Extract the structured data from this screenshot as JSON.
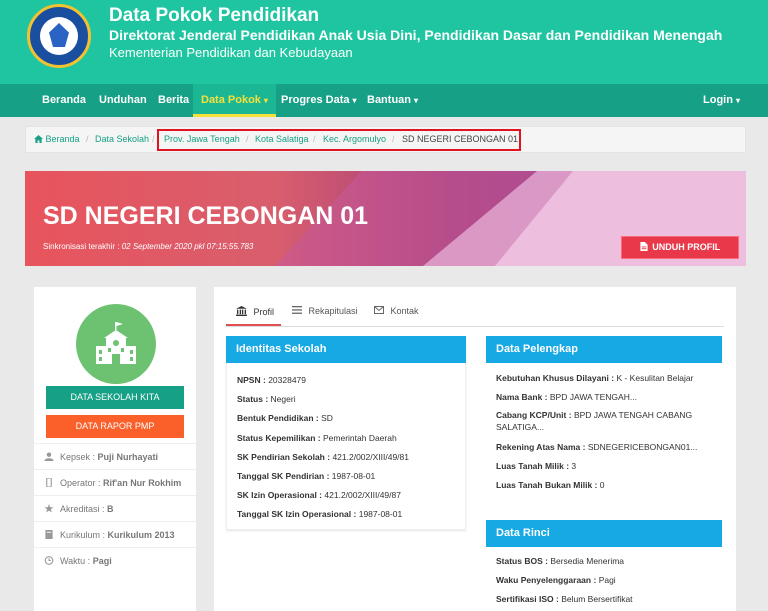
{
  "header": {
    "title": "Data Pokok Pendidikan",
    "subtitle": "Direktorat Jenderal Pendidikan Anak Usia Dini, Pendidikan Dasar dan Pendidikan Menengah",
    "ministry": "Kementerian Pendidikan dan Kebudayaan"
  },
  "nav": {
    "items": [
      "Beranda",
      "Unduhan",
      "Berita",
      "Data Pokok",
      "Progres Data",
      "Bantuan"
    ],
    "login": "Login",
    "caret": "▾"
  },
  "breadcrumb": {
    "home": "Beranda",
    "items": [
      "Data Sekolah",
      "Prov. Jawa Tengah",
      "Kota Salatiga",
      "Kec. Argomulyo"
    ],
    "current": "SD NEGERI CEBONGAN 01",
    "sep": "/"
  },
  "banner": {
    "title": "SD NEGERI CEBONGAN 01",
    "sync_label": "Sinkronisasi terakhir :",
    "sync_value": "02 September 2020 pkl 07:15:55.783",
    "download_label": "UNDUH PROFIL"
  },
  "sidebar": {
    "btn_green": "DATA SEKOLAH KITA",
    "btn_orange": "DATA RAPOR PMP",
    "rows": [
      {
        "label": "Kepsek :",
        "value": "Puji Nurhayati"
      },
      {
        "label": "Operator :",
        "value": "Rif'an Nur Rokhim"
      },
      {
        "label": "Akreditasi :",
        "value": "B"
      },
      {
        "label": "Kurikulum :",
        "value": "Kurikulum 2013"
      },
      {
        "label": "Waktu :",
        "value": "Pagi"
      }
    ]
  },
  "tabs": [
    "Profil",
    "Rekapitulasi",
    "Kontak"
  ],
  "identitas": {
    "title": "Identitas Sekolah",
    "rows": [
      {
        "label": "NPSN :",
        "value": "20328479"
      },
      {
        "label": "Status :",
        "value": "Negeri"
      },
      {
        "label": "Bentuk Pendidikan :",
        "value": "SD"
      },
      {
        "label": "Status Kepemilikan :",
        "value": "Pemerintah Daerah"
      },
      {
        "label": "SK Pendirian Sekolah :",
        "value": "421.2/002/XIII/49/81"
      },
      {
        "label": "Tanggal SK Pendirian :",
        "value": "1987-08-01"
      },
      {
        "label": "SK Izin Operasional :",
        "value": "421.2/002/XIII/49/87"
      },
      {
        "label": "Tanggal SK Izin Operasional :",
        "value": "1987-08-01"
      }
    ]
  },
  "pelengkap": {
    "title": "Data Pelengkap",
    "rows": [
      {
        "label": "Kebutuhan Khusus Dilayani :",
        "value": "K - Kesulitan Belajar"
      },
      {
        "label": "Nama Bank :",
        "value": "BPD JAWA TENGAH..."
      },
      {
        "label": "Cabang KCP/Unit :",
        "value": "BPD JAWA TENGAH CABANG SALATIGA..."
      },
      {
        "label": "Rekening Atas Nama :",
        "value": "SDNEGERICEBONGAN01..."
      },
      {
        "label": "Luas Tanah Milik :",
        "value": "3"
      },
      {
        "label": "Luas Tanah Bukan Milik :",
        "value": "0"
      }
    ]
  },
  "rinci": {
    "title": "Data Rinci",
    "rows": [
      {
        "label": "Status BOS :",
        "value": "Bersedia Menerima"
      },
      {
        "label": "Waku Penyelenggaraan :",
        "value": "Pagi"
      },
      {
        "label": "Sertifikasi ISO :",
        "value": "Belum Bersertifikat"
      }
    ]
  }
}
